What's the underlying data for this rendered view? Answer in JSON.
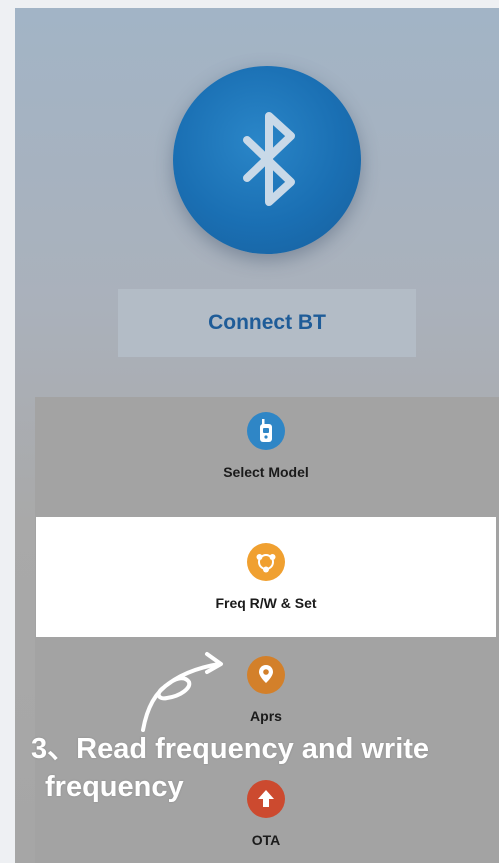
{
  "bluetooth_icon": "bluetooth-icon",
  "connect_label": "Connect BT",
  "menu": [
    {
      "label": "Select Model",
      "icon": "walkie-talkie-icon",
      "color": "#2f86c6",
      "active": false
    },
    {
      "label": "Freq R/W & Set",
      "icon": "network-share-icon",
      "color": "#f0a030",
      "active": true
    },
    {
      "label": "Aprs",
      "icon": "map-pin-icon",
      "color": "#d3802a",
      "active": false
    },
    {
      "label": "OTA",
      "icon": "upload-arrow-icon",
      "color": "#cc4a2f",
      "active": false
    }
  ],
  "caption": {
    "line1": "3、Read frequency and write",
    "line2": "frequency"
  },
  "colors": {
    "bt_blue": "#1a6fb3",
    "connect_text": "#1f5c98"
  }
}
